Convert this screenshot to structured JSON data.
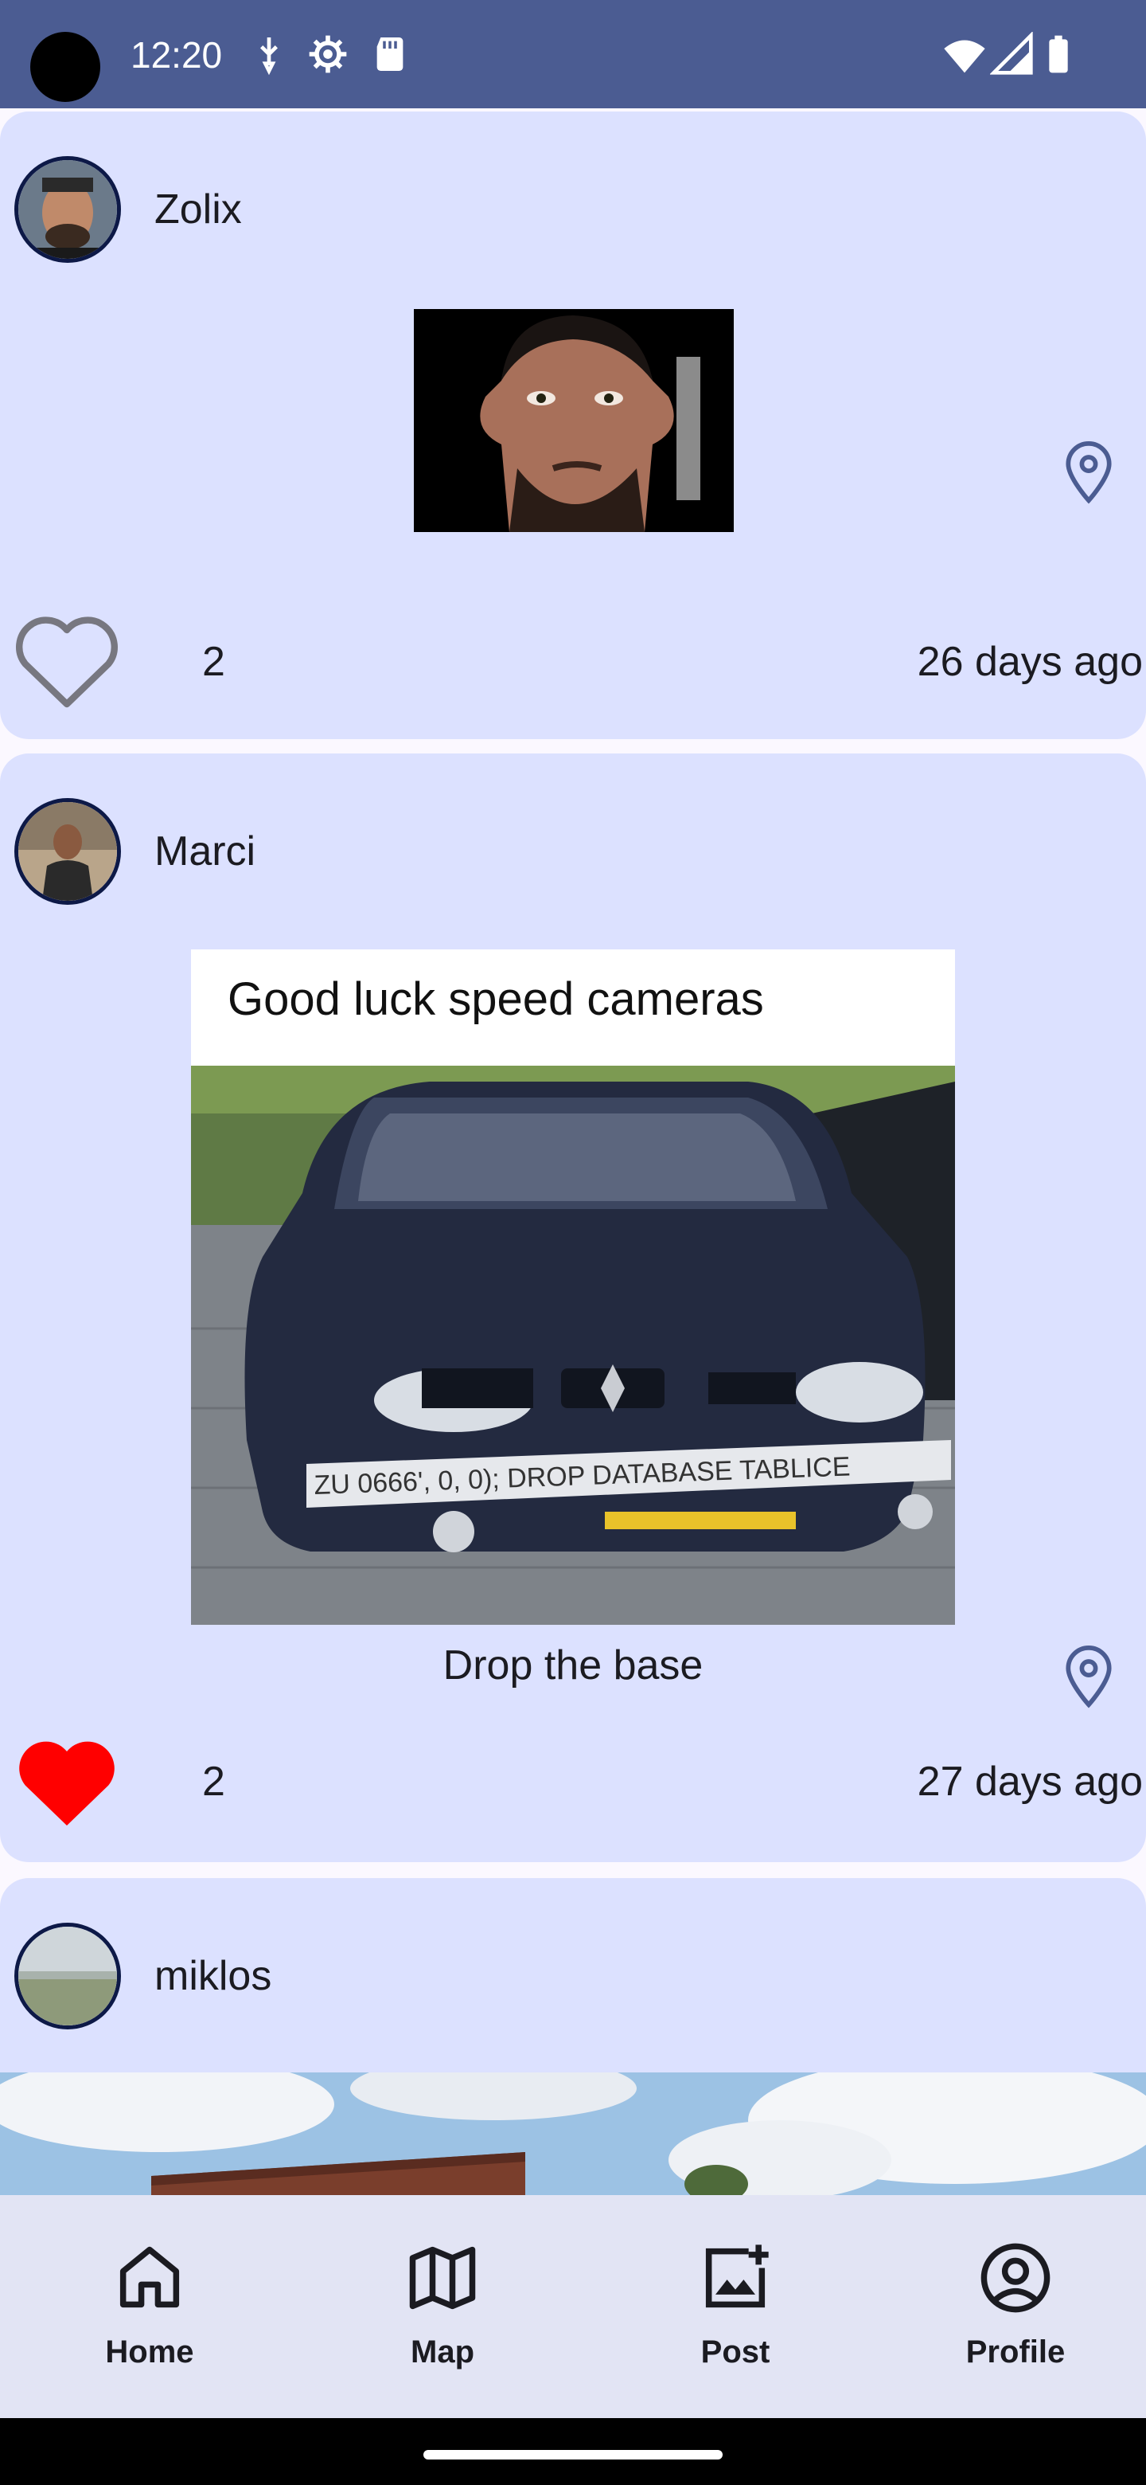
{
  "status_bar": {
    "time": "12:20",
    "icons": [
      "usb-debug-icon",
      "settings-gear-icon",
      "sd-card-icon",
      "wifi-icon",
      "cellular-signal-icon",
      "battery-icon"
    ]
  },
  "posts": [
    {
      "username": "Zolix",
      "likes": "2",
      "time": "26 days ago",
      "liked": false,
      "caption": ""
    },
    {
      "username": "Marci",
      "image_text": "Good luck speed cameras",
      "plate_text": "ZU 0666', 0, 0); DROP DATABASE TABLICE",
      "caption": "Drop the base",
      "likes": "2",
      "time": "27 days ago",
      "liked": true
    },
    {
      "username": "miklos"
    }
  ],
  "nav": {
    "items": [
      {
        "label": "Home",
        "icon": "home-icon"
      },
      {
        "label": "Map",
        "icon": "map-icon"
      },
      {
        "label": "Post",
        "icon": "add-photo-icon"
      },
      {
        "label": "Profile",
        "icon": "profile-icon"
      }
    ]
  },
  "colors": {
    "status_bar": "#4b5c92",
    "card": "#dce1ff",
    "nav": "#e2e4f4",
    "like_active": "#ff0000"
  }
}
